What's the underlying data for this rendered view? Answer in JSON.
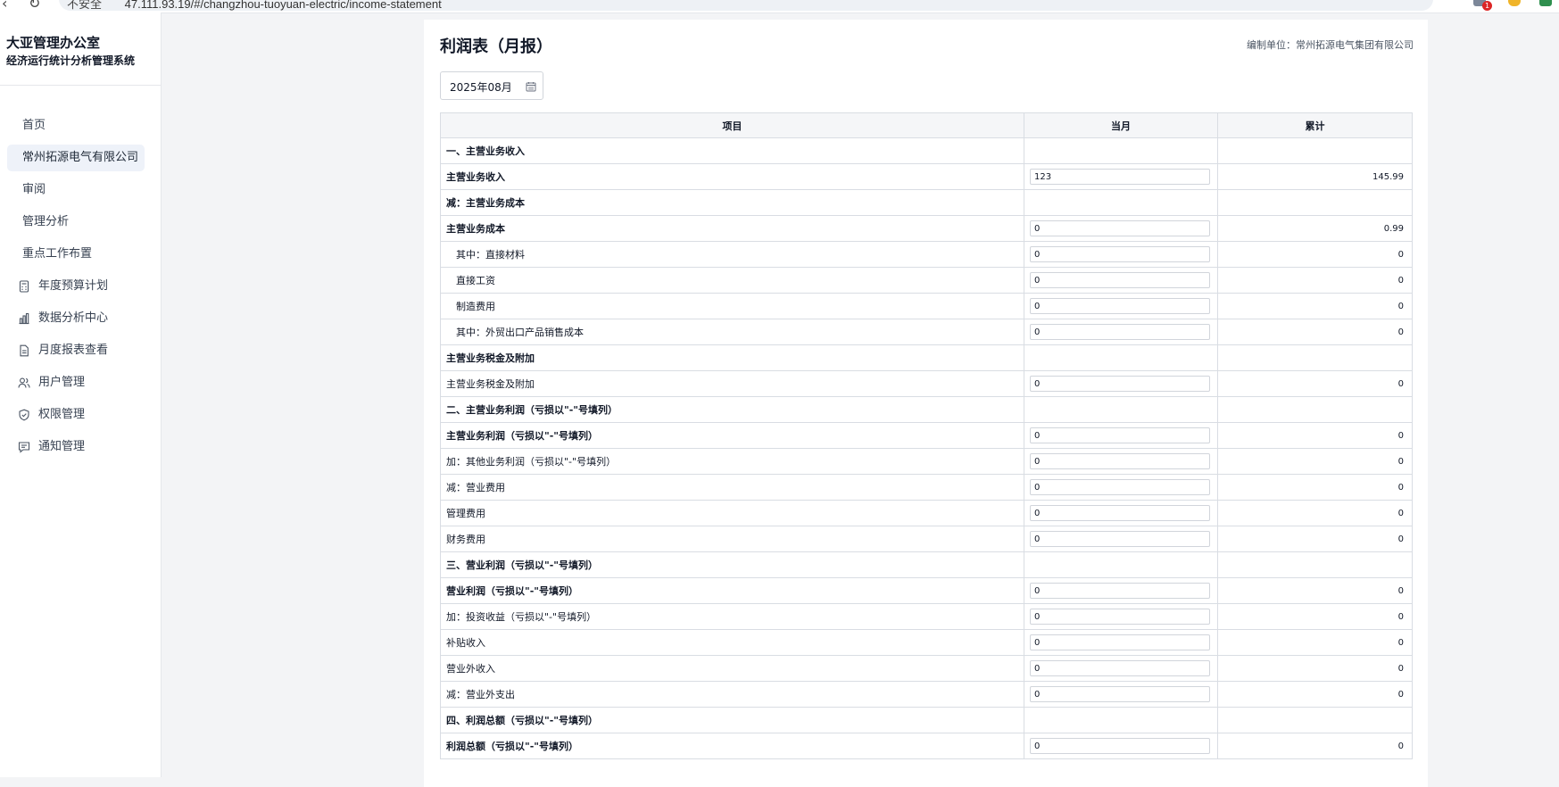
{
  "browser": {
    "security_label": "不安全",
    "url": "47.111.93.19/#/changzhou-tuoyuan-electric/income-statement",
    "extension_badge": "1"
  },
  "sidebar": {
    "brand_title": "大亚管理办公室",
    "brand_subtitle": "经济运行统计分析管理系统",
    "items": [
      {
        "label": "首页",
        "icon": "",
        "active": false
      },
      {
        "label": "常州拓源电气有限公司",
        "icon": "",
        "active": true
      },
      {
        "label": "审阅",
        "icon": "",
        "active": false
      },
      {
        "label": "管理分析",
        "icon": "",
        "active": false
      },
      {
        "label": "重点工作布置",
        "icon": "",
        "active": false
      },
      {
        "label": "年度预算计划",
        "icon": "calculator-icon",
        "active": false
      },
      {
        "label": "数据分析中心",
        "icon": "bar-chart-icon",
        "active": false
      },
      {
        "label": "月度报表查看",
        "icon": "document-icon",
        "active": false
      },
      {
        "label": "用户管理",
        "icon": "users-icon",
        "active": false
      },
      {
        "label": "权限管理",
        "icon": "shield-icon",
        "active": false
      },
      {
        "label": "通知管理",
        "icon": "message-icon",
        "active": false
      }
    ]
  },
  "main": {
    "title": "利润表（月报）",
    "prepared_by": "编制单位：常州拓源电气集团有限公司",
    "month": "2025年08月",
    "table": {
      "headers": [
        "项目",
        "当月",
        "累计"
      ],
      "rows": [
        {
          "item": "一、主营业务收入",
          "bold": true,
          "indent": false,
          "current": null,
          "cumulative": ""
        },
        {
          "item": "主营业务收入",
          "bold": true,
          "indent": false,
          "current": "123",
          "cumulative": "145.99"
        },
        {
          "item": "减：主营业务成本",
          "bold": true,
          "indent": false,
          "current": null,
          "cumulative": ""
        },
        {
          "item": "主营业务成本",
          "bold": true,
          "indent": false,
          "current": "0",
          "cumulative": "0.99"
        },
        {
          "item": "其中：直接材料",
          "bold": false,
          "indent": true,
          "current": "0",
          "cumulative": "0"
        },
        {
          "item": "直接工资",
          "bold": false,
          "indent": true,
          "current": "0",
          "cumulative": "0"
        },
        {
          "item": "制造费用",
          "bold": false,
          "indent": true,
          "current": "0",
          "cumulative": "0"
        },
        {
          "item": "其中：外贸出口产品销售成本",
          "bold": false,
          "indent": true,
          "current": "0",
          "cumulative": "0"
        },
        {
          "item": "主营业务税金及附加",
          "bold": true,
          "indent": false,
          "current": null,
          "cumulative": ""
        },
        {
          "item": "主营业务税金及附加",
          "bold": false,
          "indent": false,
          "current": "0",
          "cumulative": "0"
        },
        {
          "item": "二、主营业务利润（亏损以\"-\"号填列）",
          "bold": true,
          "indent": false,
          "current": null,
          "cumulative": ""
        },
        {
          "item": "主营业务利润（亏损以\"-\"号填列）",
          "bold": true,
          "indent": false,
          "current": "0",
          "cumulative": "0"
        },
        {
          "item": "加：其他业务利润（亏损以\"-\"号填列）",
          "bold": false,
          "indent": false,
          "current": "0",
          "cumulative": "0"
        },
        {
          "item": "减：营业费用",
          "bold": false,
          "indent": false,
          "current": "0",
          "cumulative": "0"
        },
        {
          "item": "管理费用",
          "bold": false,
          "indent": false,
          "current": "0",
          "cumulative": "0"
        },
        {
          "item": "财务费用",
          "bold": false,
          "indent": false,
          "current": "0",
          "cumulative": "0"
        },
        {
          "item": "三、营业利润（亏损以\"-\"号填列）",
          "bold": true,
          "indent": false,
          "current": null,
          "cumulative": ""
        },
        {
          "item": "营业利润（亏损以\"-\"号填列）",
          "bold": true,
          "indent": false,
          "current": "0",
          "cumulative": "0"
        },
        {
          "item": "加：投资收益（亏损以\"-\"号填列）",
          "bold": false,
          "indent": false,
          "current": "0",
          "cumulative": "0"
        },
        {
          "item": "补贴收入",
          "bold": false,
          "indent": false,
          "current": "0",
          "cumulative": "0"
        },
        {
          "item": "营业外收入",
          "bold": false,
          "indent": false,
          "current": "0",
          "cumulative": "0"
        },
        {
          "item": "减：营业外支出",
          "bold": false,
          "indent": false,
          "current": "0",
          "cumulative": "0"
        },
        {
          "item": "四、利润总额（亏损以\"-\"号填列）",
          "bold": true,
          "indent": false,
          "current": null,
          "cumulative": ""
        },
        {
          "item": "利润总额（亏损以\"-\"号填列）",
          "bold": true,
          "indent": false,
          "current": "0",
          "cumulative": "0"
        }
      ]
    }
  }
}
